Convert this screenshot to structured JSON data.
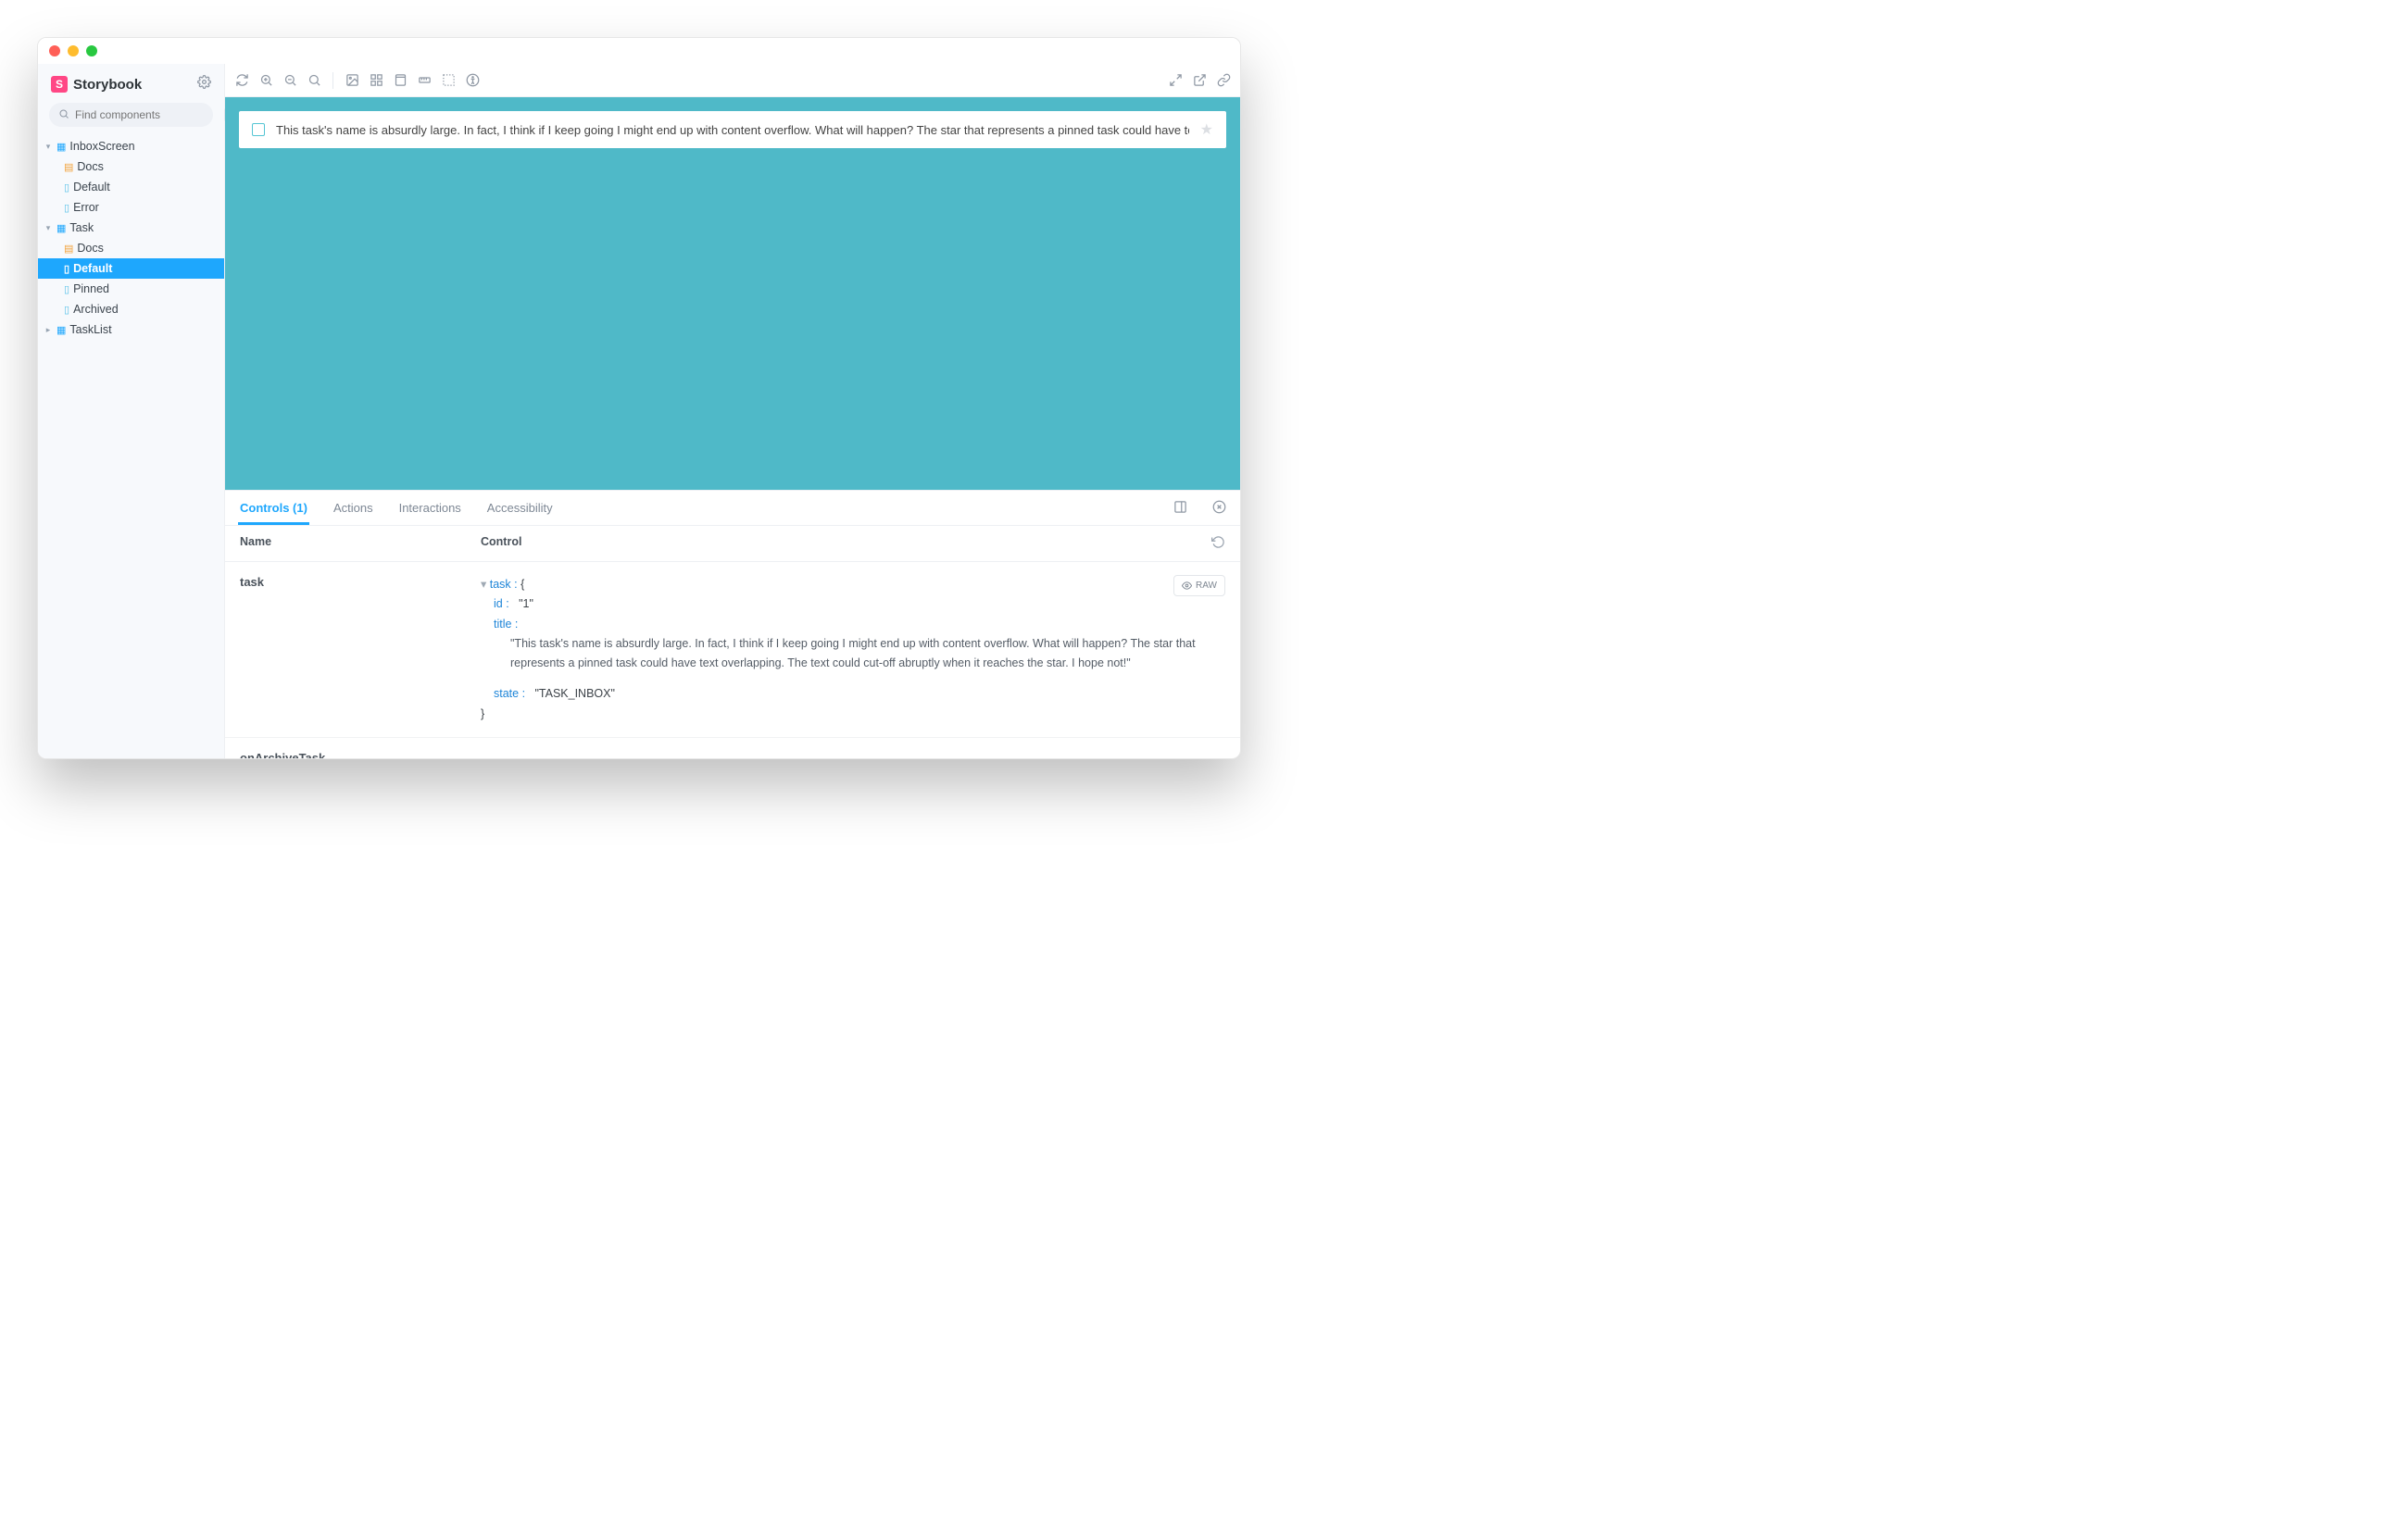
{
  "brand": {
    "title": "Storybook",
    "logo_letter": "S"
  },
  "search": {
    "placeholder": "Find components",
    "shortcut": "/"
  },
  "tree": {
    "inboxScreen": {
      "label": "InboxScreen",
      "docs": "Docs",
      "default": "Default",
      "error": "Error"
    },
    "task": {
      "label": "Task",
      "docs": "Docs",
      "default": "Default",
      "pinned": "Pinned",
      "archived": "Archived"
    },
    "taskList": {
      "label": "TaskList"
    }
  },
  "canvas": {
    "task_title": "This task's name is absurdly large. In fact, I think if I keep going I might end up with content overflow. What will happen? The star that represents a pinned task could have text"
  },
  "addons": {
    "tabs": {
      "controls": "Controls (1)",
      "actions": "Actions",
      "interactions": "Interactions",
      "accessibility": "Accessibility"
    },
    "header": {
      "name": "Name",
      "control": "Control"
    },
    "raw_label": "RAW",
    "rows": {
      "task": {
        "prop": "task",
        "root_label": "task :",
        "brace_open": "{",
        "brace_close": "}",
        "id_key": "id :",
        "id_val": "\"1\"",
        "title_key": "title :",
        "title_val": "\"This task's name is absurdly large. In fact, I think if I keep going I might end up with content overflow. What will happen? The star that represents a pinned task could have text overlapping. The text could cut-off abruptly when it reaches the star. I hope not!\"",
        "state_key": "state :",
        "state_val": "\"TASK_INBOX\""
      },
      "onArchiveTask": {
        "prop": "onArchiveTask",
        "val": "-"
      }
    }
  }
}
